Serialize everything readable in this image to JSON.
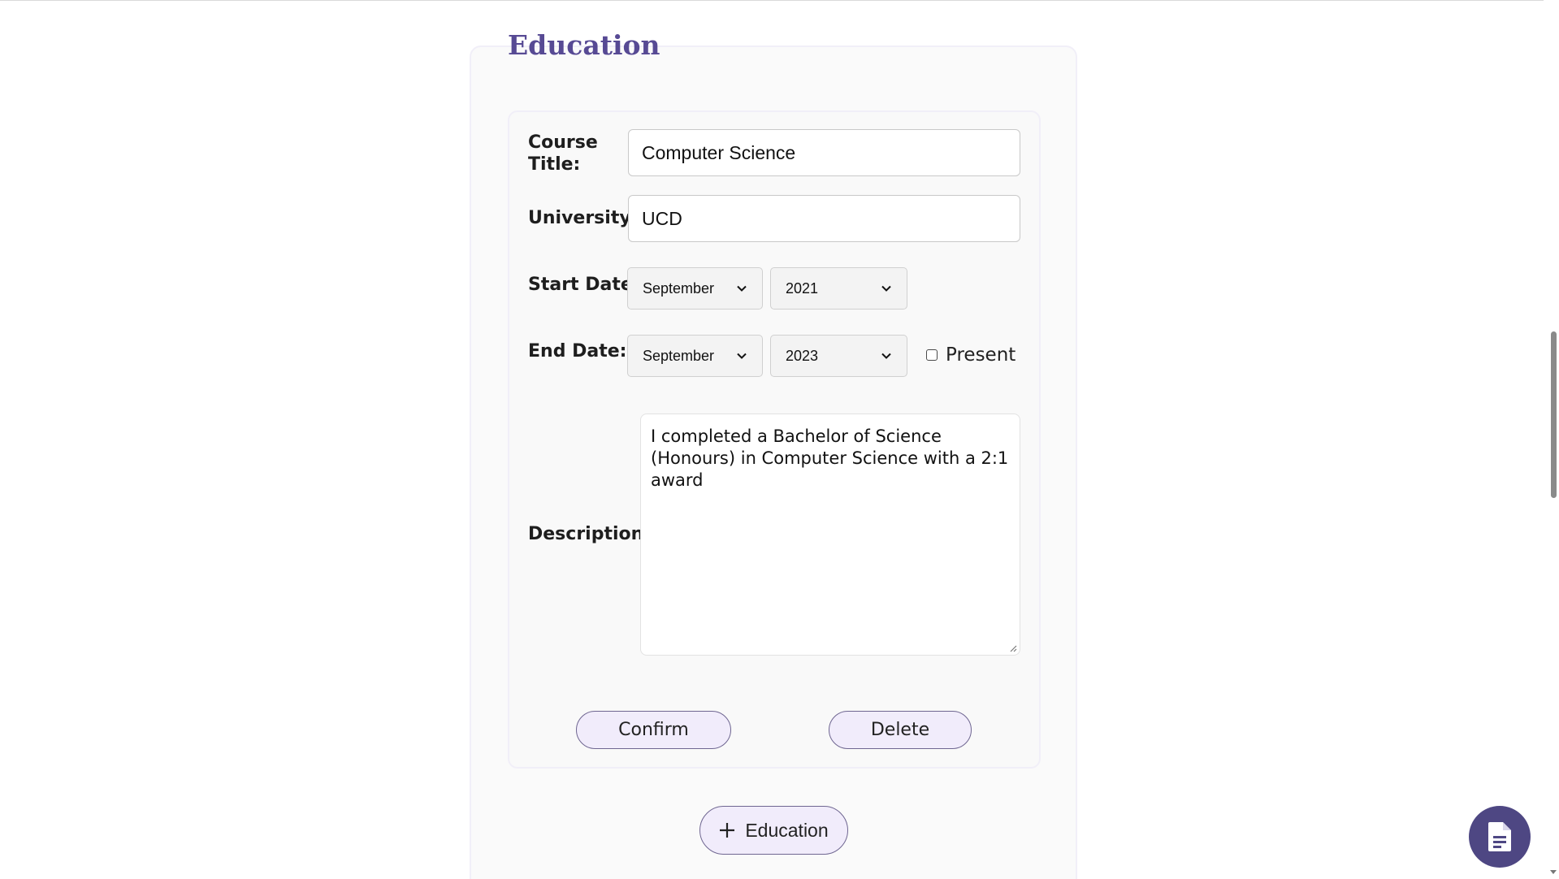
{
  "section": {
    "title": "Education"
  },
  "form": {
    "course_title_label": "Course Title:",
    "course_title_value": "Computer Science",
    "university_label": "University",
    "university_value": "UCD",
    "start_date_label": "Start Date:",
    "start_month": "September",
    "start_year": "2021",
    "end_date_label": "End Date:",
    "end_month": "September",
    "end_year": "2023",
    "present_label": "Present",
    "present_checked": false,
    "description_label": "Description:",
    "description_value": "I completed a Bachelor of Science (Honours) in Computer Science with a 2:1 award"
  },
  "actions": {
    "confirm_label": "Confirm",
    "delete_label": "Delete",
    "add_education_label": "Education"
  },
  "icons": {
    "add": "plus-icon",
    "fab": "document-icon",
    "select": "chevron-down-icon"
  },
  "colors": {
    "accent": "#574a94",
    "fab": "#4e4783",
    "button_bg": "#f1ecfb",
    "button_border": "#6f6691"
  }
}
